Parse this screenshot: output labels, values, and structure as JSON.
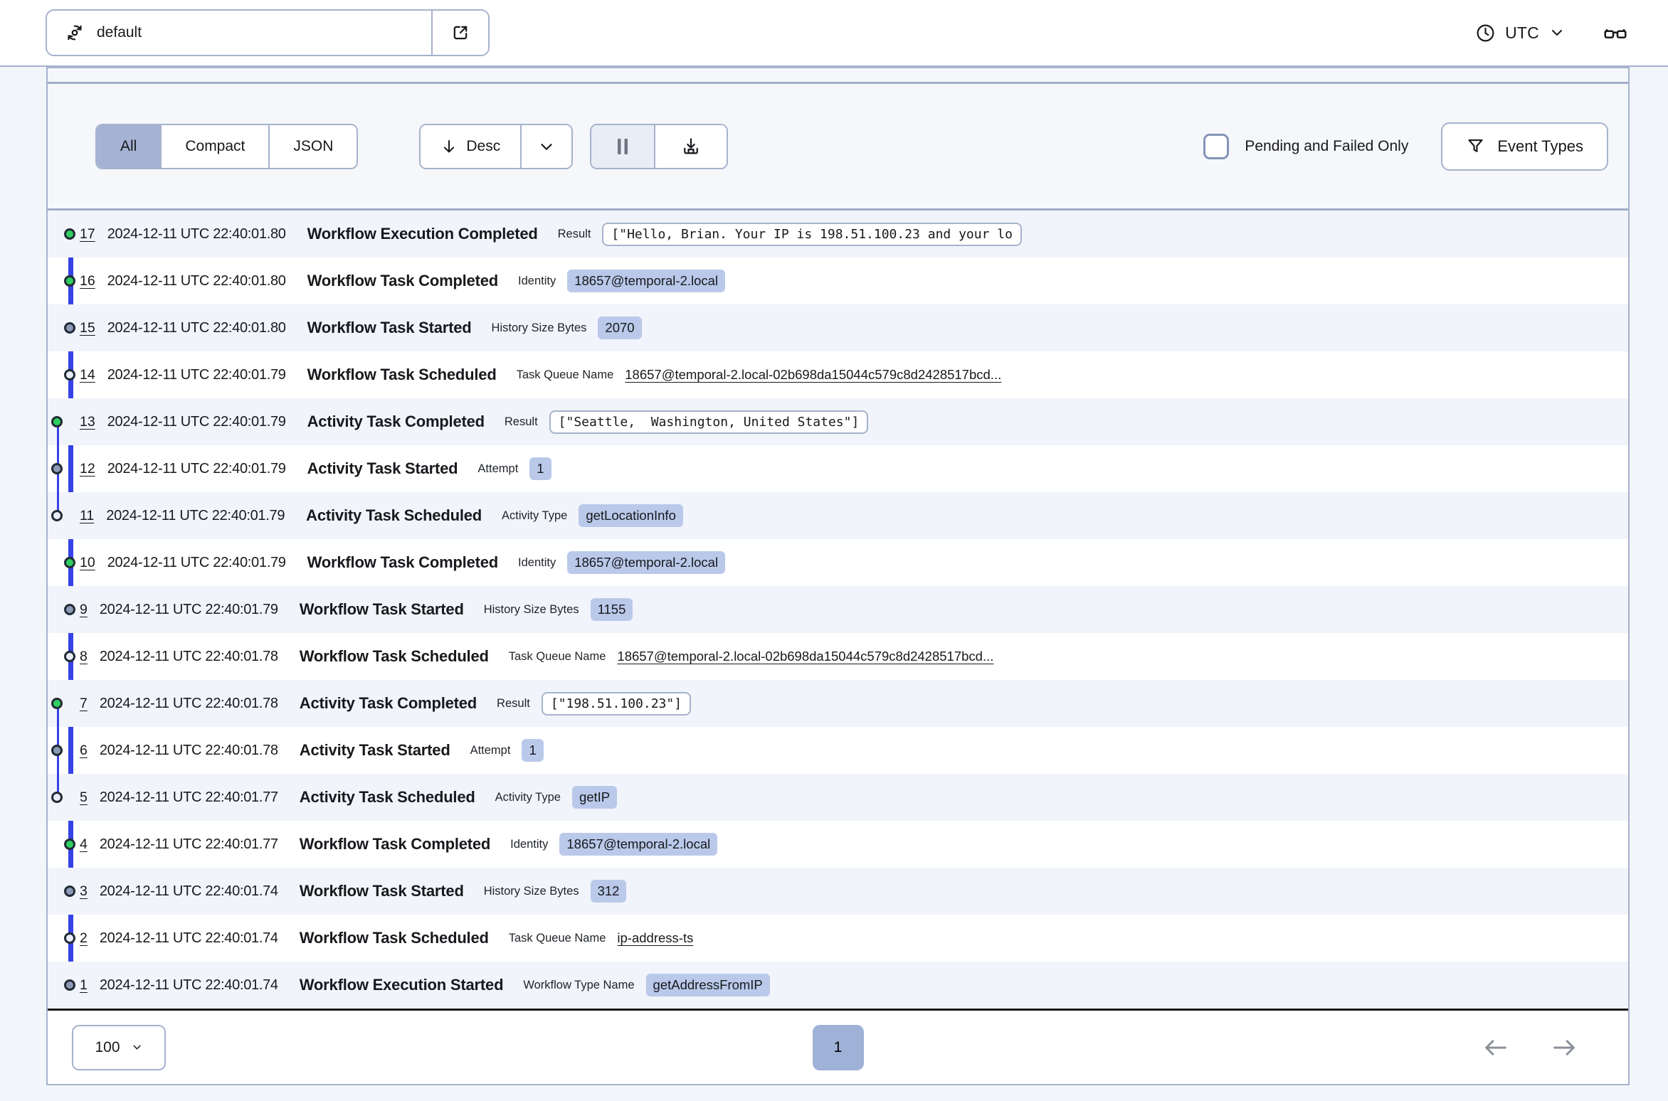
{
  "navbar": {
    "namespace": "default",
    "timezone": "UTC"
  },
  "toolbar": {
    "view_tabs": [
      {
        "label": "All",
        "active": true
      },
      {
        "label": "Compact",
        "active": false
      },
      {
        "label": "JSON",
        "active": false
      }
    ],
    "sort_label": "Desc",
    "pending_failed_label": "Pending and Failed Only",
    "pending_failed_checked": false,
    "event_types_label": "Event Types"
  },
  "events": {
    "rows": [
      {
        "id": "17",
        "time": "2024-12-11 UTC 22:40:01.80",
        "name": "Workflow Execution Completed",
        "detail_label": "Result",
        "detail_type": "code",
        "detail_value": "[\"Hello, Brian. Your IP is 198.51.100.23 and your lo",
        "clip": true,
        "marker": "completed",
        "track": "main",
        "subline": null
      },
      {
        "id": "16",
        "time": "2024-12-11 UTC 22:40:01.80",
        "name": "Workflow Task Completed",
        "detail_label": "Identity",
        "detail_type": "badge",
        "detail_value": "18657@temporal-2.local",
        "clip": false,
        "marker": "completed",
        "track": "main",
        "subline": null
      },
      {
        "id": "15",
        "time": "2024-12-11 UTC 22:40:01.80",
        "name": "Workflow Task Started",
        "detail_label": "History Size Bytes",
        "detail_type": "badge",
        "detail_value": "2070",
        "clip": false,
        "marker": "started",
        "track": "main",
        "subline": null
      },
      {
        "id": "14",
        "time": "2024-12-11 UTC 22:40:01.79",
        "name": "Workflow Task Scheduled",
        "detail_label": "Task Queue Name",
        "detail_type": "link",
        "detail_value": "18657@temporal-2.local-02b698da15044c579c8d2428517bcd...",
        "clip": false,
        "marker": "scheduled",
        "track": "main",
        "subline": null
      },
      {
        "id": "13",
        "time": "2024-12-11 UTC 22:40:01.79",
        "name": "Activity Task Completed",
        "detail_label": "Result",
        "detail_type": "code",
        "detail_value": "[\"Seattle,  Washington, United States\"]",
        "clip": false,
        "marker": "completed",
        "track": "activity",
        "subline": "start"
      },
      {
        "id": "12",
        "time": "2024-12-11 UTC 22:40:01.79",
        "name": "Activity Task Started",
        "detail_label": "Attempt",
        "detail_type": "badge",
        "detail_value": "1",
        "clip": false,
        "marker": "started",
        "track": "activity",
        "subline": "mid"
      },
      {
        "id": "11",
        "time": "2024-12-11 UTC 22:40:01.79",
        "name": "Activity Task Scheduled",
        "detail_label": "Activity Type",
        "detail_type": "badge",
        "detail_value": "getLocationInfo",
        "clip": false,
        "marker": "scheduled",
        "track": "activity",
        "subline": "end"
      },
      {
        "id": "10",
        "time": "2024-12-11 UTC 22:40:01.79",
        "name": "Workflow Task Completed",
        "detail_label": "Identity",
        "detail_type": "badge",
        "detail_value": "18657@temporal-2.local",
        "clip": false,
        "marker": "completed",
        "track": "main",
        "subline": null
      },
      {
        "id": "9",
        "time": "2024-12-11 UTC 22:40:01.79",
        "name": "Workflow Task Started",
        "detail_label": "History Size Bytes",
        "detail_type": "badge",
        "detail_value": "1155",
        "clip": false,
        "marker": "started",
        "track": "main",
        "subline": null
      },
      {
        "id": "8",
        "time": "2024-12-11 UTC 22:40:01.78",
        "name": "Workflow Task Scheduled",
        "detail_label": "Task Queue Name",
        "detail_type": "link",
        "detail_value": "18657@temporal-2.local-02b698da15044c579c8d2428517bcd...",
        "clip": false,
        "marker": "scheduled",
        "track": "main",
        "subline": null
      },
      {
        "id": "7",
        "time": "2024-12-11 UTC 22:40:01.78",
        "name": "Activity Task Completed",
        "detail_label": "Result",
        "detail_type": "code",
        "detail_value": "[\"198.51.100.23\"]",
        "clip": false,
        "marker": "completed",
        "track": "activity",
        "subline": "start"
      },
      {
        "id": "6",
        "time": "2024-12-11 UTC 22:40:01.78",
        "name": "Activity Task Started",
        "detail_label": "Attempt",
        "detail_type": "badge",
        "detail_value": "1",
        "clip": false,
        "marker": "started",
        "track": "activity",
        "subline": "mid"
      },
      {
        "id": "5",
        "time": "2024-12-11 UTC 22:40:01.77",
        "name": "Activity Task Scheduled",
        "detail_label": "Activity Type",
        "detail_type": "badge",
        "detail_value": "getIP",
        "clip": false,
        "marker": "scheduled",
        "track": "activity",
        "subline": "end"
      },
      {
        "id": "4",
        "time": "2024-12-11 UTC 22:40:01.77",
        "name": "Workflow Task Completed",
        "detail_label": "Identity",
        "detail_type": "badge",
        "detail_value": "18657@temporal-2.local",
        "clip": false,
        "marker": "completed",
        "track": "main",
        "subline": null
      },
      {
        "id": "3",
        "time": "2024-12-11 UTC 22:40:01.74",
        "name": "Workflow Task Started",
        "detail_label": "History Size Bytes",
        "detail_type": "badge",
        "detail_value": "312",
        "clip": false,
        "marker": "started",
        "track": "main",
        "subline": null
      },
      {
        "id": "2",
        "time": "2024-12-11 UTC 22:40:01.74",
        "name": "Workflow Task Scheduled",
        "detail_label": "Task Queue Name",
        "detail_type": "link",
        "detail_value": "ip-address-ts",
        "clip": false,
        "marker": "scheduled",
        "track": "main",
        "subline": null
      },
      {
        "id": "1",
        "time": "2024-12-11 UTC 22:40:01.74",
        "name": "Workflow Execution Started",
        "detail_label": "Workflow Type Name",
        "detail_type": "badge",
        "detail_value": "getAddressFromIP",
        "clip": false,
        "marker": "started",
        "track": "main",
        "subline": null
      }
    ]
  },
  "pagination": {
    "page_size": "100",
    "current_page": "1"
  },
  "icons": {
    "namespace": "namespace-switcher-icon",
    "external_link": "external-link-icon",
    "clock": "clock-icon",
    "chevron_down": "chevron-down-icon",
    "glasses": "glasses-icon",
    "arrow_down": "arrow-down-icon",
    "pause": "pause-icon",
    "download": "download-icon",
    "funnel": "filter-funnel-icon",
    "arrow_left": "arrow-left-icon",
    "arrow_right": "arrow-right-icon"
  },
  "colors": {
    "timeline_blue": "#3642e6",
    "completed_green": "#2fd05f",
    "started_gray": "#8c9bb5",
    "scheduled_light": "#e9eefb",
    "badge_bg": "#bac9ea",
    "active_segment": "#a5b2d4",
    "panel_border": "#a6b3cd"
  }
}
